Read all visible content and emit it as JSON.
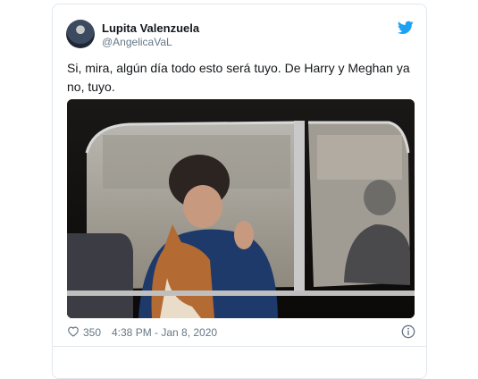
{
  "tweet": {
    "author_name": "Lupita Valenzuela",
    "author_handle": "@AngelicaVaL",
    "text": "Si, mira, algún día todo esto será tuyo. De Harry y Meghan ya no, tuyo.",
    "likes": "350",
    "timestamp": "4:38 PM - Jan 8, 2020",
    "reply_teaser": ""
  },
  "icons": {
    "platform": "twitter-bird-icon",
    "like": "heart-icon",
    "info": "info-icon"
  },
  "colors": {
    "accent": "#1da1f2",
    "text": "#14171a",
    "muted": "#657786"
  }
}
